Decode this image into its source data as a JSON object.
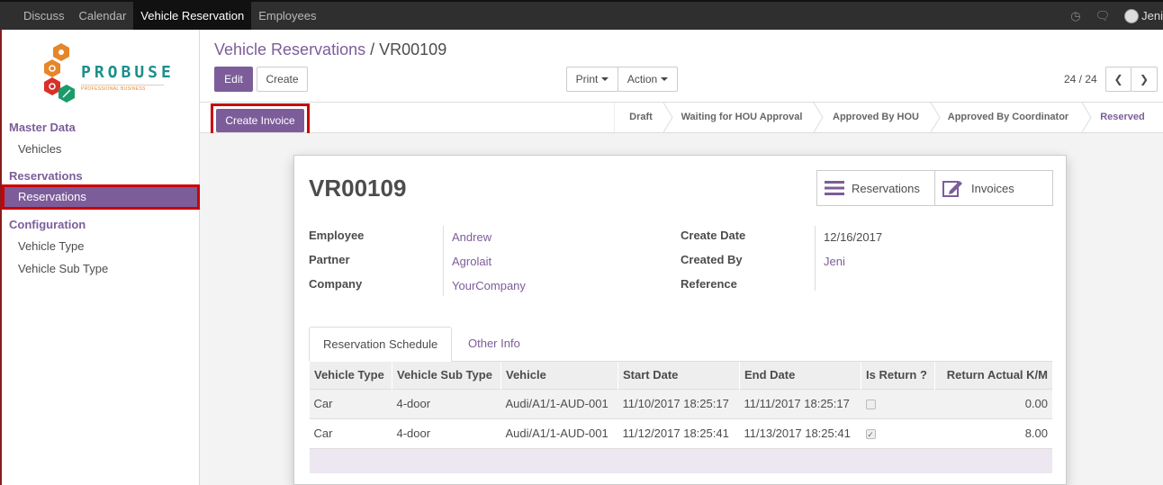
{
  "topbar": {
    "menu": [
      "Discuss",
      "Calendar",
      "Vehicle Reservation",
      "Employees"
    ],
    "active_index": 2,
    "user": "Jeni"
  },
  "sidebar": {
    "logo_word": "PROBUSE",
    "logo_tag": "PROFESSIONAL BUSINESS",
    "sections": [
      {
        "title": "Master Data",
        "items": [
          "Vehicles"
        ]
      },
      {
        "title": "Reservations",
        "items": [
          "Reservations"
        ]
      },
      {
        "title": "Configuration",
        "items": [
          "Vehicle Type",
          "Vehicle Sub Type"
        ]
      }
    ]
  },
  "breadcrumb": {
    "parent": "Vehicle Reservations",
    "separator": "/",
    "current": "VR00109"
  },
  "buttons": {
    "edit": "Edit",
    "create": "Create",
    "print": "Print",
    "action": "Action",
    "create_invoice": "Create Invoice"
  },
  "pager": {
    "text": "24 / 24"
  },
  "stages": [
    "Draft",
    "Waiting for HOU Approval",
    "Approved By HOU",
    "Approved By Coordinator",
    "Reserved"
  ],
  "current_stage": "Reserved",
  "smart_buttons": {
    "reservations": "Reservations",
    "invoices": "Invoices"
  },
  "record": {
    "name": "VR00109",
    "left_fields": [
      {
        "label": "Employee",
        "value": "Andrew"
      },
      {
        "label": "Partner",
        "value": "Agrolait"
      },
      {
        "label": "Company",
        "value": "YourCompany"
      }
    ],
    "right_fields": [
      {
        "label": "Create Date",
        "value": "12/16/2017"
      },
      {
        "label": "Created By",
        "value": "Jeni"
      },
      {
        "label": "Reference",
        "value": ""
      }
    ]
  },
  "tabs": [
    "Reservation Schedule",
    "Other Info"
  ],
  "schedule": {
    "columns": [
      "Vehicle Type",
      "Vehicle Sub Type",
      "Vehicle",
      "Start Date",
      "End Date",
      "Is Return ?",
      "Return Actual K/M"
    ],
    "rows": [
      {
        "vehicle_type": "Car",
        "sub_type": "4-door",
        "vehicle": "Audi/A1/1-AUD-001",
        "start": "11/10/2017 18:25:17",
        "end": "11/11/2017 18:25:17",
        "is_return": false,
        "km": "0.00"
      },
      {
        "vehicle_type": "Car",
        "sub_type": "4-door",
        "vehicle": "Audi/A1/1-AUD-001",
        "start": "11/12/2017 18:25:41",
        "end": "11/13/2017 18:25:41",
        "is_return": true,
        "km": "8.00"
      }
    ]
  },
  "colors": {
    "primary": "#7c5d9a",
    "topbar": "#2f2f2f",
    "highlight": "#cc0000",
    "teal": "#1c8f8c",
    "orange": "#e6862b"
  }
}
